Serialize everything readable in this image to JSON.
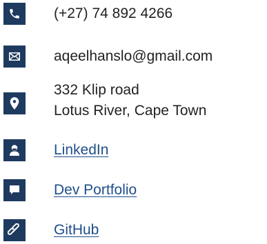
{
  "contacts": {
    "phone": {
      "icon": "phone-icon",
      "text": "(+27) 74 892 4266"
    },
    "email": {
      "icon": "envelope-icon",
      "text": "aqeelhanslo@gmail.com"
    },
    "address": {
      "icon": "location-pin-icon",
      "line1": "332 Klip road",
      "line2": "Lotus River, Cape Town"
    },
    "linkedin": {
      "icon": "person-icon",
      "text": "LinkedIn"
    },
    "portfolio": {
      "icon": "chat-bubble-icon",
      "text": "Dev Portfolio"
    },
    "github": {
      "icon": "link-icon",
      "text": "GitHub"
    }
  },
  "colors": {
    "icon_background": "#1e3a5f",
    "icon_foreground": "#ffffff",
    "text": "#222222",
    "link": "#1f4e89"
  }
}
